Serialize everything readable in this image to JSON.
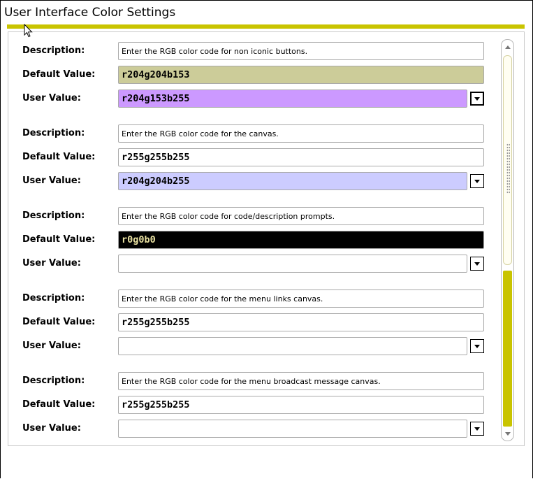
{
  "title": "User Interface Color Settings",
  "labels": {
    "description": "Description:",
    "default_value": "Default Value:",
    "user_value": "User Value:"
  },
  "colors": {
    "accent_bar": "#c9c400",
    "scroll_track": "#c9c400"
  },
  "settings": [
    {
      "description": "Enter the RGB color code for non iconic buttons.",
      "default_value": "r204g204b153",
      "default_bg": "#cccc99",
      "default_fg": "#000000",
      "user_value": "r204g153b255",
      "user_bg": "#cc99ff",
      "dropdown_focused": true
    },
    {
      "description": "Enter the RGB color code for the canvas.",
      "default_value": "r255g255b255",
      "default_bg": "#ffffff",
      "default_fg": "#000000",
      "user_value": "r204g204b255",
      "user_bg": "#ccccff",
      "dropdown_focused": false
    },
    {
      "description": "Enter the RGB color code for code/description prompts.",
      "default_value": "r0g0b0",
      "default_bg": "#000000",
      "default_fg": "#e8e0a0",
      "user_value": "",
      "user_bg": "#ffffff",
      "dropdown_focused": false
    },
    {
      "description": "Enter the RGB color code for the menu links canvas.",
      "default_value": "r255g255b255",
      "default_bg": "#ffffff",
      "default_fg": "#000000",
      "user_value": "",
      "user_bg": "#ffffff",
      "dropdown_focused": false
    },
    {
      "description": "Enter the RGB color code for the menu broadcast message canvas.",
      "default_value": "r255g255b255",
      "default_bg": "#ffffff",
      "default_fg": "#000000",
      "user_value": "",
      "user_bg": "#ffffff",
      "dropdown_focused": false
    }
  ],
  "icons": {
    "pointer": "mouse-pointer-icon",
    "dropdown": "chevron-down-icon",
    "scroll_up": "scroll-up-arrow-icon",
    "scroll_down": "scroll-down-arrow-icon"
  }
}
